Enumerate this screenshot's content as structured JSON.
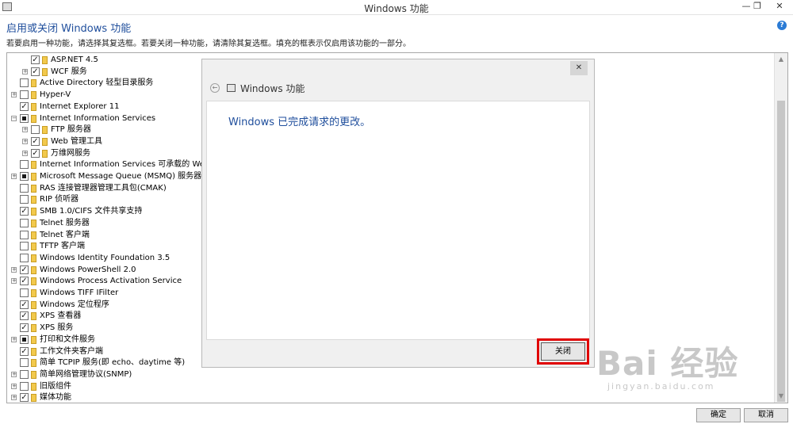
{
  "window": {
    "title": "Windows 功能",
    "minimize_label": "—",
    "restore_label": "❐",
    "close_label": "✕"
  },
  "heading": "启用或关闭 Windows 功能",
  "help_label": "?",
  "description": "若要启用一种功能，请选择其复选框。若要关闭一种功能，请清除其复选框。填充的框表示仅启用该功能的一部分。",
  "features": [
    {
      "label": "ASP.NET 4.5",
      "state": "checked",
      "expandable": false,
      "indent": 1
    },
    {
      "label": "WCF 服务",
      "state": "checked",
      "expandable": true,
      "indent": 1
    },
    {
      "label": "Active Directory 轻型目录服务",
      "state": "unchecked",
      "expandable": false,
      "indent": 0
    },
    {
      "label": "Hyper-V",
      "state": "unchecked",
      "expandable": true,
      "indent": 0
    },
    {
      "label": "Internet Explorer 11",
      "state": "checked",
      "expandable": false,
      "indent": 0
    },
    {
      "label": "Internet Information Services",
      "state": "partial",
      "expandable": true,
      "expanded": true,
      "indent": 0
    },
    {
      "label": "FTP 服务器",
      "state": "unchecked",
      "expandable": true,
      "indent": 1
    },
    {
      "label": "Web 管理工具",
      "state": "checked",
      "expandable": true,
      "indent": 1
    },
    {
      "label": "万维网服务",
      "state": "checked",
      "expandable": true,
      "indent": 1
    },
    {
      "label": "Internet Information Services 可承载的 Web 核心",
      "state": "unchecked",
      "expandable": false,
      "indent": 0
    },
    {
      "label": "Microsoft Message Queue (MSMQ) 服务器",
      "state": "partial",
      "expandable": true,
      "indent": 0
    },
    {
      "label": "RAS 连接管理器管理工具包(CMAK)",
      "state": "unchecked",
      "expandable": false,
      "indent": 0
    },
    {
      "label": "RIP 侦听器",
      "state": "unchecked",
      "expandable": false,
      "indent": 0
    },
    {
      "label": "SMB 1.0/CIFS 文件共享支持",
      "state": "checked",
      "expandable": false,
      "indent": 0
    },
    {
      "label": "Telnet 服务器",
      "state": "unchecked",
      "expandable": false,
      "indent": 0
    },
    {
      "label": "Telnet 客户端",
      "state": "unchecked",
      "expandable": false,
      "indent": 0
    },
    {
      "label": "TFTP 客户端",
      "state": "unchecked",
      "expandable": false,
      "indent": 0
    },
    {
      "label": "Windows Identity Foundation 3.5",
      "state": "unchecked",
      "expandable": false,
      "indent": 0
    },
    {
      "label": "Windows PowerShell 2.0",
      "state": "checked",
      "expandable": true,
      "indent": 0
    },
    {
      "label": "Windows Process Activation Service",
      "state": "checked",
      "expandable": true,
      "indent": 0
    },
    {
      "label": "Windows TIFF IFilter",
      "state": "unchecked",
      "expandable": false,
      "indent": 0
    },
    {
      "label": "Windows 定位程序",
      "state": "checked",
      "expandable": false,
      "indent": 0
    },
    {
      "label": "XPS 查看器",
      "state": "checked",
      "expandable": false,
      "indent": 0
    },
    {
      "label": "XPS 服务",
      "state": "checked",
      "expandable": false,
      "indent": 0
    },
    {
      "label": "打印和文件服务",
      "state": "partial",
      "expandable": true,
      "indent": 0
    },
    {
      "label": "工作文件夹客户端",
      "state": "checked",
      "expandable": false,
      "indent": 0
    },
    {
      "label": "简单 TCPIP 服务(即 echo、daytime 等)",
      "state": "unchecked",
      "expandable": false,
      "indent": 0
    },
    {
      "label": "简单网络管理协议(SNMP)",
      "state": "unchecked",
      "expandable": true,
      "indent": 0
    },
    {
      "label": "旧版组件",
      "state": "unchecked",
      "expandable": true,
      "indent": 0
    },
    {
      "label": "媒体功能",
      "state": "checked",
      "expandable": true,
      "indent": 0
    }
  ],
  "dialog": {
    "close_x": "✕",
    "back_label": "←",
    "title": "Windows 功能",
    "message": "Windows 已完成请求的更改。",
    "close_button": "关闭"
  },
  "buttons": {
    "ok": "确定",
    "cancel": "取消"
  },
  "watermark": {
    "logo_text": "Bai 经验",
    "url": "jingyan.baidu.com"
  },
  "colors": {
    "accent_blue": "#1f4e9c",
    "highlight_red": "#e00000"
  }
}
